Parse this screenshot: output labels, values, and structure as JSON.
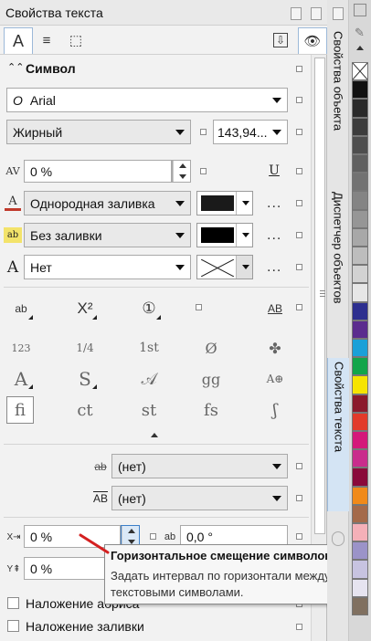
{
  "window": {
    "title": "Свойства текста"
  },
  "toolbar_tabs": [
    {
      "icon": "character-a-icon",
      "glyph": "A"
    },
    {
      "icon": "paragraph-lines-icon",
      "glyph": "≡"
    },
    {
      "icon": "frame-icon",
      "glyph": "⬚"
    }
  ],
  "section": {
    "title": "Символ"
  },
  "font": {
    "family": "Arial",
    "style": "Жирный",
    "size": "143,94..."
  },
  "kerning": {
    "value": "0 %"
  },
  "fill": {
    "label": "Однородная заливка",
    "color": "#1a1a1a"
  },
  "background_fill": {
    "label": "Без заливки",
    "color": "#000000"
  },
  "outline": {
    "label": "Нет"
  },
  "glyph_rows": [
    [
      "ab",
      "X²",
      "①",
      "",
      "AB"
    ],
    [
      "123",
      "1/4",
      "1st",
      "Ø",
      "✤"
    ],
    [
      "A",
      "S",
      "𝒜",
      "gg",
      "A⊕"
    ],
    [
      "fi",
      "ct",
      "st",
      "fs",
      "ʃ"
    ]
  ],
  "strikethrough": {
    "value": "(нет)"
  },
  "overline": {
    "value": "(нет)"
  },
  "horizontal_shift": {
    "value": "0 %"
  },
  "rotation": {
    "value": "0,0 °"
  },
  "vertical_shift": {
    "value": "0 %"
  },
  "checkboxes": [
    {
      "label": "Наложение абриса"
    },
    {
      "label": "Наложение заливки"
    }
  ],
  "tooltip": {
    "title": "Горизонтальное смещение символов",
    "body": "Задать интервал по горизонтали между текстовыми символами."
  },
  "side_tabs": [
    {
      "label": "Свойства объекта"
    },
    {
      "label": "Диспетчер объектов"
    },
    {
      "label": "Свойства текста"
    }
  ],
  "palette": [
    "#ffffff",
    "#111111",
    "#2a2a2a",
    "#3c3c3c",
    "#4e4e4e",
    "#606060",
    "#727272",
    "#848484",
    "#969696",
    "#a8a8a8",
    "#bdbdbd",
    "#d2d2d2",
    "#e6e6e6",
    "#2d2f8f",
    "#5b2c8e",
    "#1aa0d8",
    "#12a54a",
    "#f6e400",
    "#8b1a2c",
    "#e23a2a",
    "#d4187a",
    "#c92c8c",
    "#8a0a3a",
    "#f08a1a",
    "#a46a4a",
    "#f4b0b8",
    "#9b93c8",
    "#c7c3e0",
    "#e6e4f0",
    "#807060"
  ]
}
